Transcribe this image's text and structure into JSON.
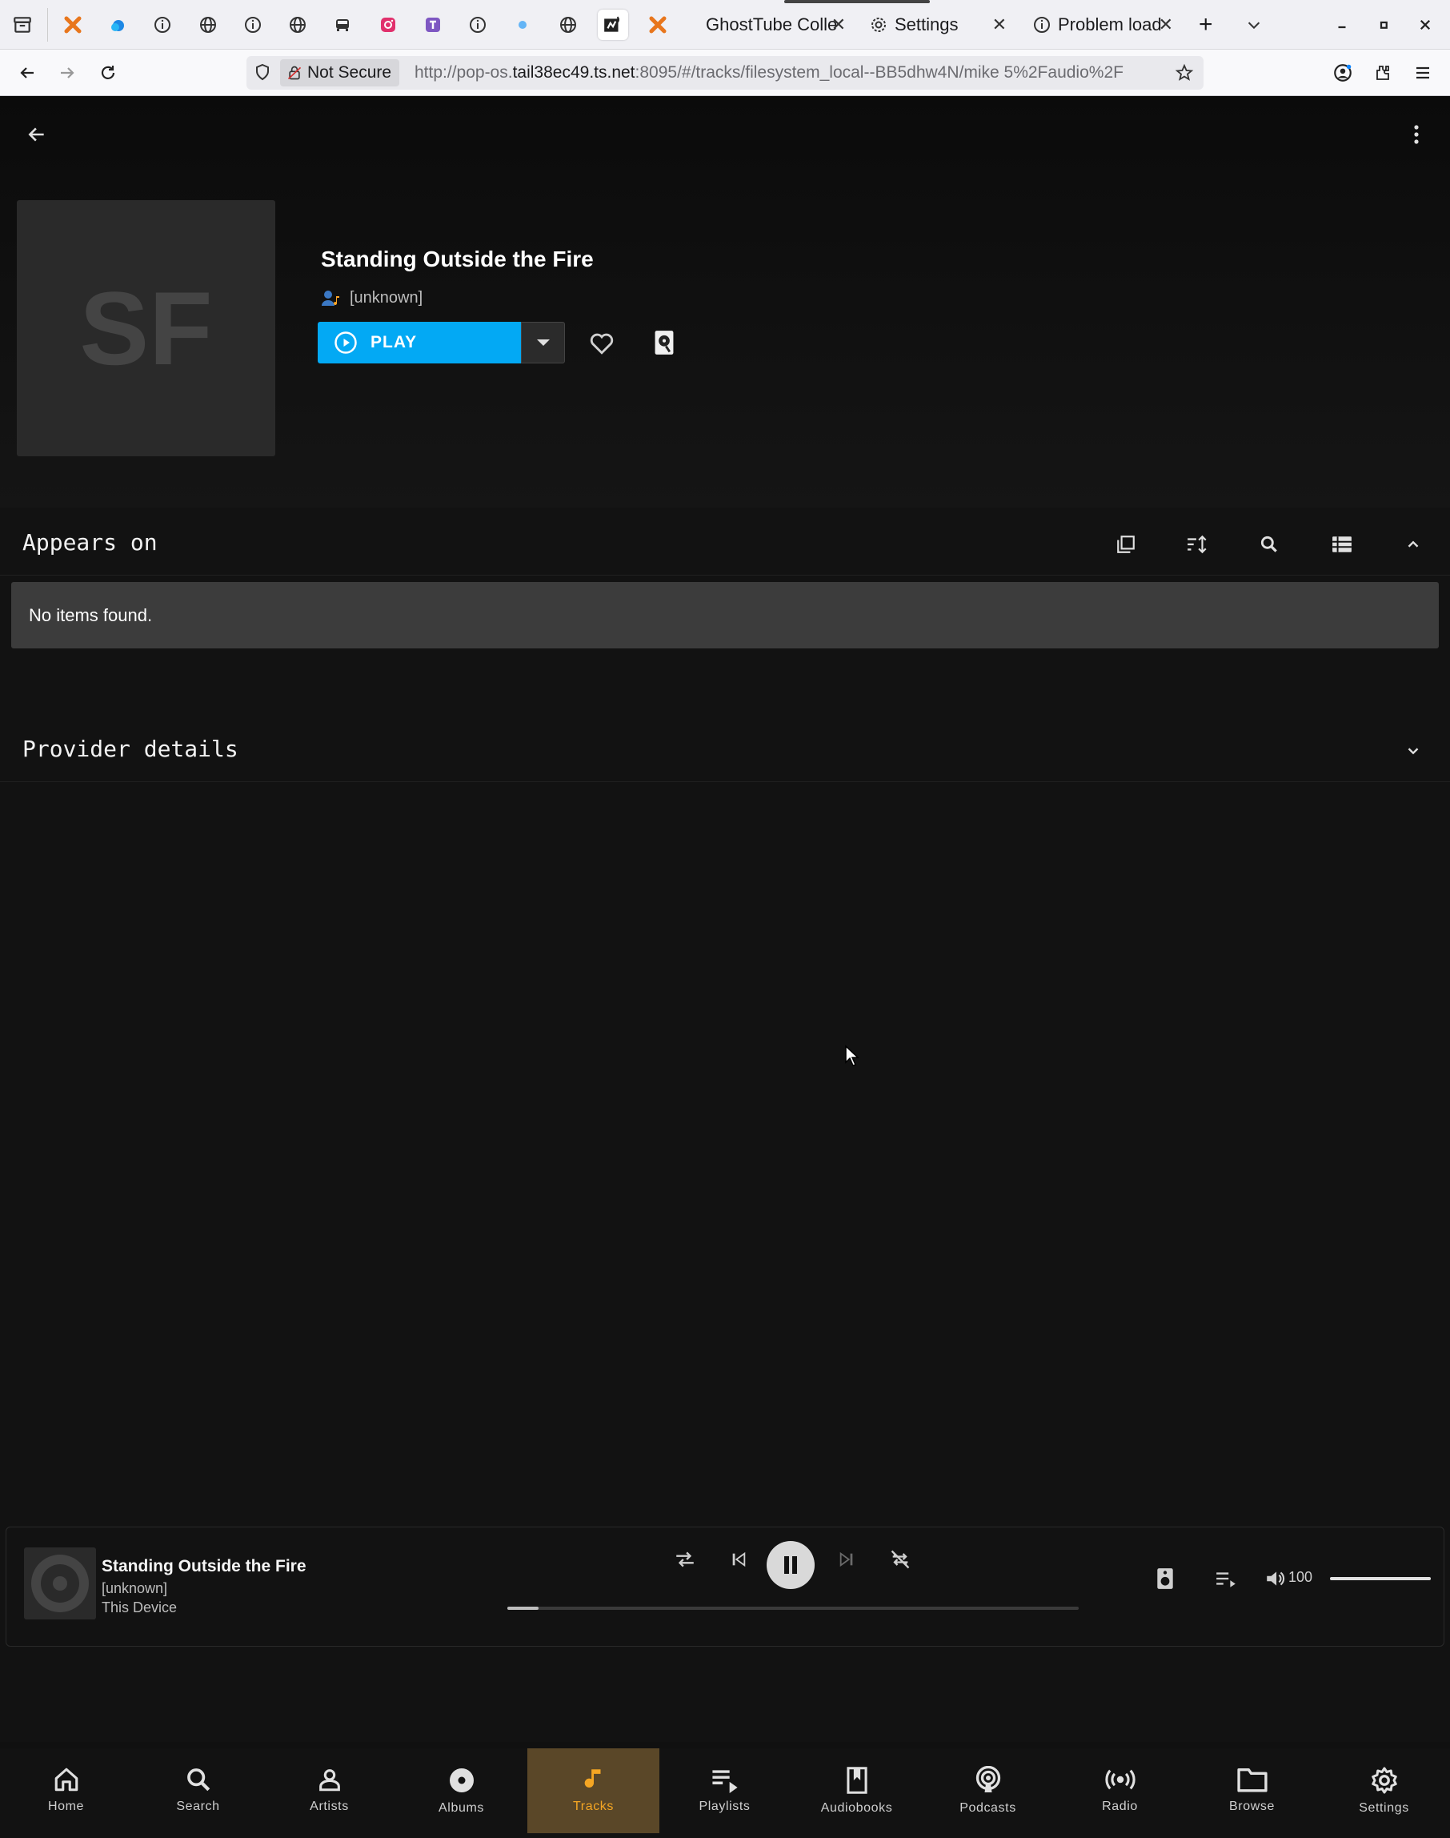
{
  "browser": {
    "tabs": [
      {
        "label": "GhostTube Colle",
        "close": "✕"
      },
      {
        "label": "Settings",
        "close": "✕"
      },
      {
        "label": "Problem load",
        "close": "✕"
      }
    ],
    "new_tab": "+",
    "url_security": "Not Secure",
    "url_prefix": "http://pop-os.",
    "url_host": "tail38ec49.ts.net",
    "url_rest": ":8095/#/tracks/filesystem_local--BB5dhw4N/mike 5%2Faudio%2F"
  },
  "header": {
    "cover_initials": "SF",
    "track_title": "Standing Outside the Fire",
    "artist": "[unknown]",
    "play_label": "PLAY"
  },
  "appears_on": {
    "title": "Appears on",
    "empty_text": "No items found."
  },
  "provider_details": {
    "title": "Provider details"
  },
  "player": {
    "title": "Standing Outside the Fire",
    "artist": "[unknown]",
    "device": "This Device",
    "volume": "100",
    "progress_fraction": 0.055,
    "volume_fraction": 1.0
  },
  "bottom_nav": [
    {
      "label": "Home",
      "icon": "home-icon"
    },
    {
      "label": "Search",
      "icon": "search-icon"
    },
    {
      "label": "Artists",
      "icon": "person-icon"
    },
    {
      "label": "Albums",
      "icon": "disc-icon"
    },
    {
      "label": "Tracks",
      "icon": "music-note-icon",
      "active": true
    },
    {
      "label": "Playlists",
      "icon": "playlist-icon"
    },
    {
      "label": "Audiobooks",
      "icon": "book-icon"
    },
    {
      "label": "Podcasts",
      "icon": "podcast-icon"
    },
    {
      "label": "Radio",
      "icon": "radio-icon"
    },
    {
      "label": "Browse",
      "icon": "folder-icon"
    },
    {
      "label": "Settings",
      "icon": "gear-icon"
    }
  ],
  "colors": {
    "accent": "#03a9f4",
    "active_nav": "#f5a623",
    "background": "#121212"
  }
}
